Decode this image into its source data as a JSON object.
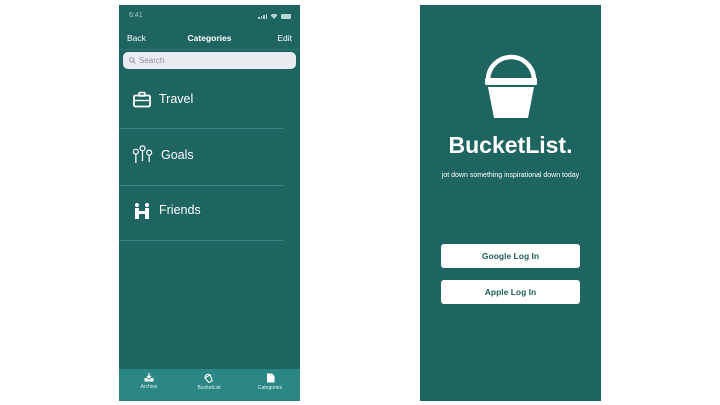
{
  "categories_screen": {
    "status": {
      "time": "6:41"
    },
    "nav": {
      "back": "Back",
      "title": "Categories",
      "edit": "Edit"
    },
    "search": {
      "placeholder": "Search"
    },
    "items": [
      {
        "label": "Travel",
        "icon": "briefcase-icon"
      },
      {
        "label": "Goals",
        "icon": "goals-pins-icon"
      },
      {
        "label": "Friends",
        "icon": "friends-icon"
      }
    ],
    "tabs": [
      {
        "label": "Archive",
        "icon": "archive-icon"
      },
      {
        "label": "BucketList",
        "icon": "bucketlist-icon"
      },
      {
        "label": "Categories",
        "icon": "categories-icon"
      }
    ]
  },
  "login_screen": {
    "brand": "BucketList.",
    "tagline": "jot down something inspirational down today",
    "google_button": "Google Log In",
    "apple_button": "Apple Log In"
  },
  "colors": {
    "screen_background": "#1e6461",
    "tab_bar": "#2a8783",
    "search_field": "#e9edf2",
    "button_text": "#1e5f5c"
  }
}
